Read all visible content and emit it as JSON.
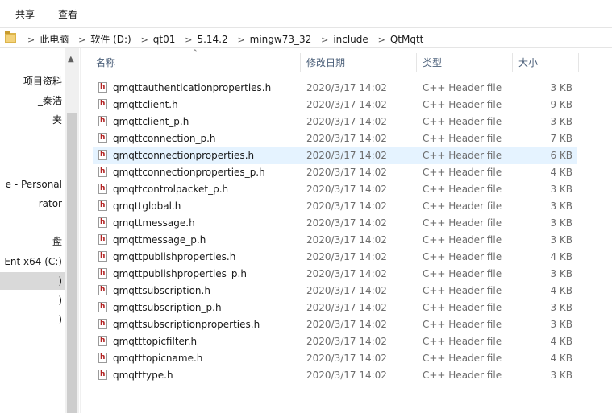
{
  "ribbon": {
    "tabs": [
      "共享",
      "查看"
    ]
  },
  "address": {
    "segments": [
      "此电脑",
      "软件 (D:)",
      "qt01",
      "5.14.2",
      "mingw73_32",
      "include",
      "QtMqtt"
    ]
  },
  "nav": {
    "items": [
      {
        "label": "项目资料",
        "selected": false
      },
      {
        "label": "_秦浩",
        "selected": false
      },
      {
        "label": "夹",
        "selected": false
      },
      {
        "label": "e - Personal",
        "selected": false
      },
      {
        "label": "rator",
        "selected": false
      },
      {
        "label": "盘",
        "selected": false
      },
      {
        "label": "Ent x64 (C:)",
        "selected": false
      },
      {
        "label": ")",
        "selected": true
      },
      {
        "label": ")",
        "selected": false
      },
      {
        "label": ")",
        "selected": false
      }
    ]
  },
  "columns": {
    "name": "名称",
    "date": "修改日期",
    "type": "类型",
    "size": "大小"
  },
  "files": [
    {
      "name": "qmqttauthenticationproperties.h",
      "date": "2020/3/17 14:02",
      "type": "C++ Header file",
      "size": "3 KB"
    },
    {
      "name": "qmqttclient.h",
      "date": "2020/3/17 14:02",
      "type": "C++ Header file",
      "size": "9 KB"
    },
    {
      "name": "qmqttclient_p.h",
      "date": "2020/3/17 14:02",
      "type": "C++ Header file",
      "size": "3 KB"
    },
    {
      "name": "qmqttconnection_p.h",
      "date": "2020/3/17 14:02",
      "type": "C++ Header file",
      "size": "7 KB"
    },
    {
      "name": "qmqttconnectionproperties.h",
      "date": "2020/3/17 14:02",
      "type": "C++ Header file",
      "size": "6 KB"
    },
    {
      "name": "qmqttconnectionproperties_p.h",
      "date": "2020/3/17 14:02",
      "type": "C++ Header file",
      "size": "4 KB"
    },
    {
      "name": "qmqttcontrolpacket_p.h",
      "date": "2020/3/17 14:02",
      "type": "C++ Header file",
      "size": "3 KB"
    },
    {
      "name": "qmqttglobal.h",
      "date": "2020/3/17 14:02",
      "type": "C++ Header file",
      "size": "3 KB"
    },
    {
      "name": "qmqttmessage.h",
      "date": "2020/3/17 14:02",
      "type": "C++ Header file",
      "size": "3 KB"
    },
    {
      "name": "qmqttmessage_p.h",
      "date": "2020/3/17 14:02",
      "type": "C++ Header file",
      "size": "3 KB"
    },
    {
      "name": "qmqttpublishproperties.h",
      "date": "2020/3/17 14:02",
      "type": "C++ Header file",
      "size": "4 KB"
    },
    {
      "name": "qmqttpublishproperties_p.h",
      "date": "2020/3/17 14:02",
      "type": "C++ Header file",
      "size": "3 KB"
    },
    {
      "name": "qmqttsubscription.h",
      "date": "2020/3/17 14:02",
      "type": "C++ Header file",
      "size": "4 KB"
    },
    {
      "name": "qmqttsubscription_p.h",
      "date": "2020/3/17 14:02",
      "type": "C++ Header file",
      "size": "3 KB"
    },
    {
      "name": "qmqttsubscriptionproperties.h",
      "date": "2020/3/17 14:02",
      "type": "C++ Header file",
      "size": "3 KB"
    },
    {
      "name": "qmqtttopicfilter.h",
      "date": "2020/3/17 14:02",
      "type": "C++ Header file",
      "size": "4 KB"
    },
    {
      "name": "qmqtttopicname.h",
      "date": "2020/3/17 14:02",
      "type": "C++ Header file",
      "size": "4 KB"
    },
    {
      "name": "qmqtttype.h",
      "date": "2020/3/17 14:02",
      "type": "C++ Header file",
      "size": "3 KB"
    }
  ],
  "hover_row": 4,
  "file_icon_glyph": "h",
  "colors": {
    "hover": "#e5f3ff",
    "selected_nav": "#d9d9d9",
    "header_text": "#4c607a",
    "folder": "#dcb44a"
  }
}
